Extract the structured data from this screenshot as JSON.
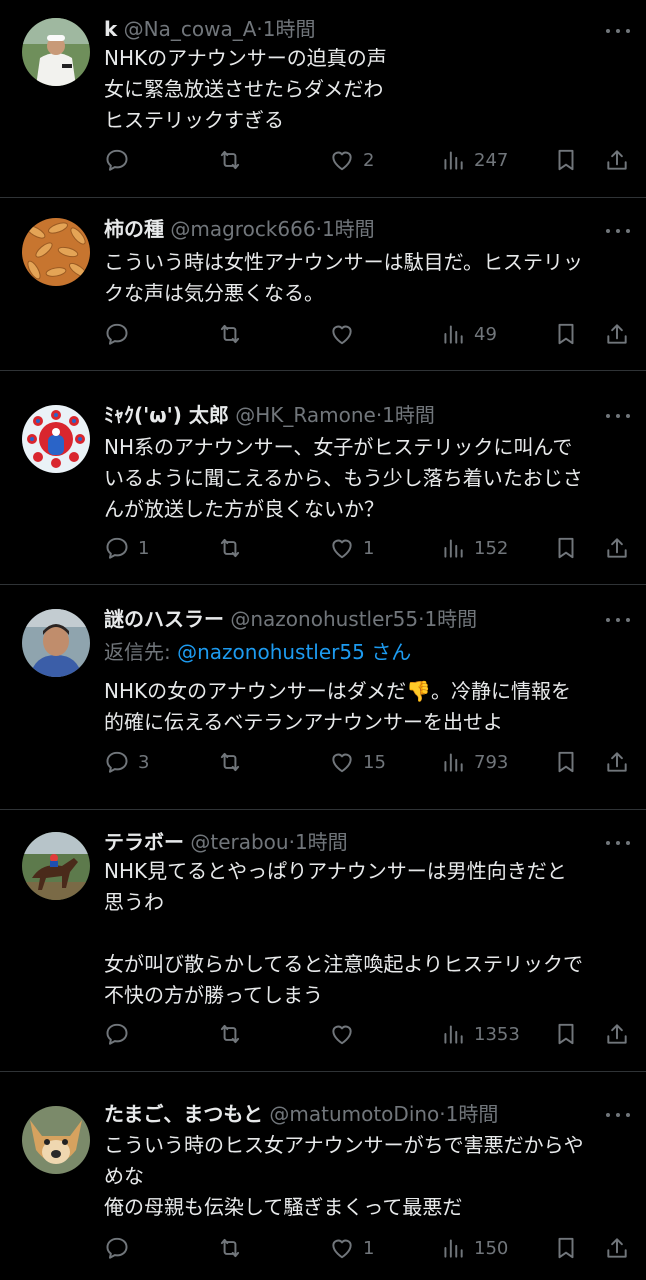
{
  "tweets": [
    {
      "name": "k",
      "handle": "@Na_cowa_A",
      "time": "1時間",
      "lines": [
        "NHKのアナウンサーの迫真の声",
        "女に緊急放送させたらダメだわ",
        "ヒステリックすぎる"
      ],
      "replies": "",
      "retweets": "",
      "likes": "2",
      "views": "247",
      "avatar": "golfer-photo"
    },
    {
      "name": "柿の種",
      "handle": "@magrock666",
      "time": "1時間",
      "lines": [
        "こういう時は女性アナウンサーは駄目だ。ヒステリッ",
        "クな声は気分悪くなる。"
      ],
      "replies": "",
      "retweets": "",
      "likes": "",
      "views": "49",
      "avatar": "rice-crackers-photo"
    },
    {
      "name": "ﾐｬｸ('ω') 太郎",
      "handle": "@HK_Ramone",
      "time": "1時間",
      "lines": [
        "NH系のアナウンサー、女子がヒステリックに叫んで",
        "いるように聞こえるから、もう少し落ち着いたおじさ",
        "んが放送した方が良くないか？"
      ],
      "replies": "1",
      "retweets": "",
      "likes": "1",
      "views": "152",
      "avatar": "mascot-illustration"
    },
    {
      "name": "謎のハスラー",
      "handle": "@nazonohustler55",
      "time": "1時間",
      "reply_label": "返信先:",
      "reply_handle": "@nazonohustler55",
      "reply_suffix": "さん",
      "lines": [
        "NHKの女のアナウンサーはダメだ👎。冷静に情報を",
        "的確に伝えるベテランアナウンサーを出せよ"
      ],
      "replies": "3",
      "retweets": "",
      "likes": "15",
      "views": "793",
      "avatar": "man-photo"
    },
    {
      "name": "テラボー",
      "handle": "@terabou",
      "time": "1時間",
      "lines": [
        "NHK見てるとやっぱりアナウンサーは男性向きだと",
        "思うわ",
        "",
        "女が叫び散らかしてると注意喚起よりヒステリックで",
        "不快の方が勝ってしまう"
      ],
      "replies": "",
      "retweets": "",
      "likes": "",
      "views": "1353",
      "avatar": "horse-race-photo"
    },
    {
      "name": "たまご、まつもと",
      "handle": "@matumotoDino",
      "time": "1時間",
      "lines": [
        "こういう時のヒス女アナウンサーがちで害悪だからや",
        "めな",
        "俺の母親も伝染して騒ぎまくって最悪だ"
      ],
      "replies": "",
      "retweets": "",
      "likes": "1",
      "views": "150",
      "avatar": "dog-photo"
    }
  ],
  "icons": {
    "reply": "speech-bubble-icon",
    "retweet": "retweet-arrows-icon",
    "like": "heart-icon",
    "views": "bar-chart-icon",
    "bookmark": "bookmark-icon",
    "share": "share-upload-icon",
    "more": "ellipsis-icon"
  },
  "colors": {
    "background": "#000000",
    "text": "#e7e9ea",
    "muted": "#71767b",
    "link": "#1d9bf0",
    "separator": "#2f3336"
  }
}
